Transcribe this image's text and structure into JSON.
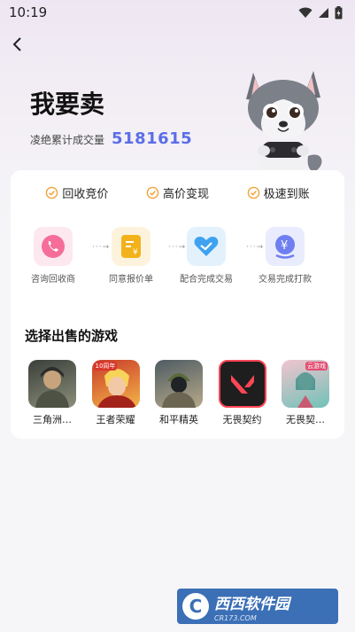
{
  "status_bar": {
    "time": "10:19"
  },
  "header": {
    "title": "我要卖",
    "stat_label": "凌绝累计成交量",
    "stat_value": "5181615"
  },
  "benefits": [
    {
      "label": "回收竞价",
      "icon": "check-circle-icon"
    },
    {
      "label": "高价变现",
      "icon": "check-circle-icon"
    },
    {
      "label": "极速到账",
      "icon": "check-circle-icon"
    }
  ],
  "steps": [
    {
      "label": "咨询回收商",
      "icon": "phone-icon",
      "color": "#f56e9a",
      "bg": "#fde8ef"
    },
    {
      "label": "同意报价单",
      "icon": "quote-doc-icon",
      "color": "#f2b21b",
      "bg": "#fdf3dc"
    },
    {
      "label": "配合完成交易",
      "icon": "handshake-icon",
      "color": "#3fa2f0",
      "bg": "#e3f1fd"
    },
    {
      "label": "交易完成打款",
      "icon": "yuan-payment-icon",
      "color": "#6f7ff0",
      "bg": "#e9ecfd"
    }
  ],
  "games_section": {
    "title": "选择出售的游戏"
  },
  "games": [
    {
      "name": "三角洲…",
      "colors": [
        "#3a3f3a",
        "#8c8f7a"
      ]
    },
    {
      "name": "王者荣耀",
      "colors": [
        "#c93b2a",
        "#f3b548"
      ],
      "badge": "10周年"
    },
    {
      "name": "和平精英",
      "colors": [
        "#4e5c63",
        "#b7a98a"
      ]
    },
    {
      "name": "无畏契约",
      "colors": [
        "#1e1e1e",
        "#ff4655"
      ]
    },
    {
      "name": "无畏契…",
      "colors": [
        "#c95a70",
        "#6fc2b7"
      ],
      "badge": "云游戏"
    }
  ],
  "watermark": {
    "logo": "C",
    "text": "西西软件园",
    "sub": "CR173.COM"
  }
}
